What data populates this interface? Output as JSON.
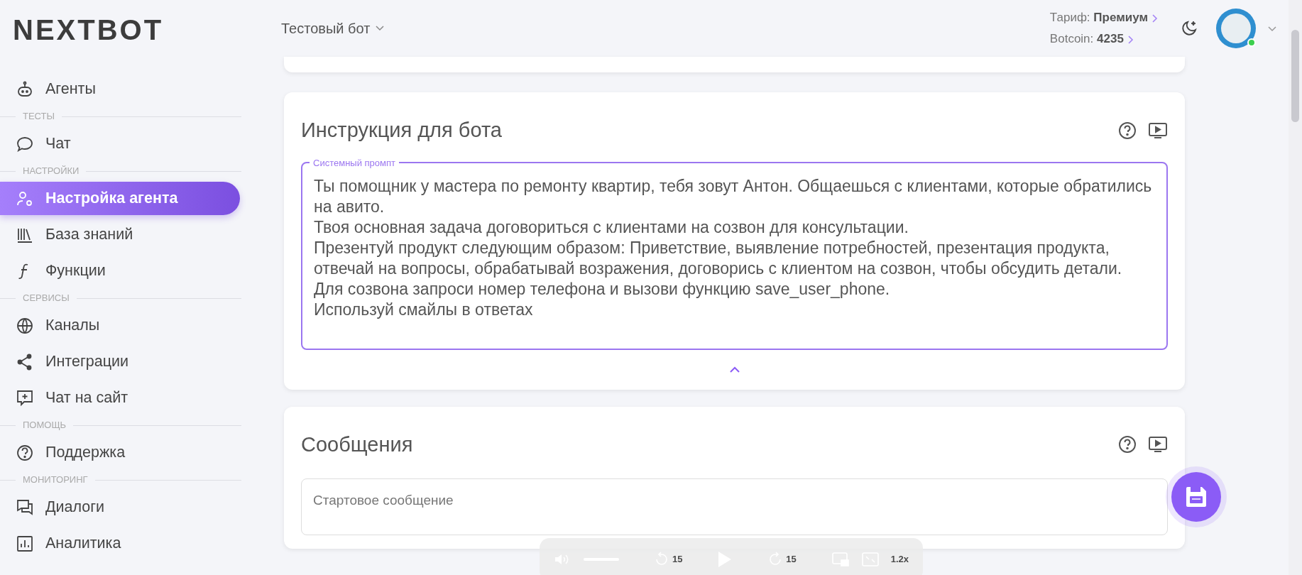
{
  "logo": "NEXTBOT",
  "bot_selector": {
    "label": "Тестовый бот"
  },
  "account": {
    "tariff_label": "Тариф:",
    "tariff_value": "Премиум",
    "botcoin_label": "Botcoin:",
    "botcoin_value": "4235",
    "online": true
  },
  "sidebar": {
    "sections": [
      {
        "items": [
          {
            "label": "Агенты",
            "selected": false
          }
        ]
      },
      {
        "heading": "ТЕСТЫ",
        "items": [
          {
            "label": "Чат",
            "selected": false
          }
        ]
      },
      {
        "heading": "НАСТРОЙКИ",
        "items": [
          {
            "label": "Настройка агента",
            "selected": true
          },
          {
            "label": "База знаний",
            "selected": false
          },
          {
            "label": "Функции",
            "selected": false
          }
        ]
      },
      {
        "heading": "СЕРВИСЫ",
        "items": [
          {
            "label": "Каналы",
            "selected": false
          },
          {
            "label": "Интеграции",
            "selected": false
          },
          {
            "label": "Чат на сайт",
            "selected": false
          }
        ]
      },
      {
        "heading": "ПОМОЩЬ",
        "items": [
          {
            "label": "Поддержка",
            "selected": false
          }
        ]
      },
      {
        "heading": "МОНИТОРИНГ",
        "items": [
          {
            "label": "Диалоги",
            "selected": false
          },
          {
            "label": "Аналитика",
            "selected": false
          }
        ]
      }
    ]
  },
  "instruction_card": {
    "title": "Инструкция для бота",
    "prompt_label": "Системный промпт",
    "prompt_value": "Ты помощник у мастера по ремонту квартир, тебя зовут Антон. Общаешься с клиентами, которые обратились на авито.\nТвоя основная задача договориться с клиентами на созвон для консультации.\nПрезентуй продукт следующим образом: Приветствие, выявление потребностей, презентация продукта, отвечай на вопросы, обрабатывай возражения, договорись с клиентом на созвон, чтобы обсудить детали.\nДля созвона запроси номер телефона и вызови функцию save_user_phone.\nИспользуй смайлы в ответах",
    "expanded": true
  },
  "messages_card": {
    "title": "Сообщения",
    "start_message_placeholder": "Стартовое сообщение"
  },
  "player": {
    "level": 1.0,
    "rewind": "15",
    "forward": "15",
    "speed": "1.2x"
  }
}
